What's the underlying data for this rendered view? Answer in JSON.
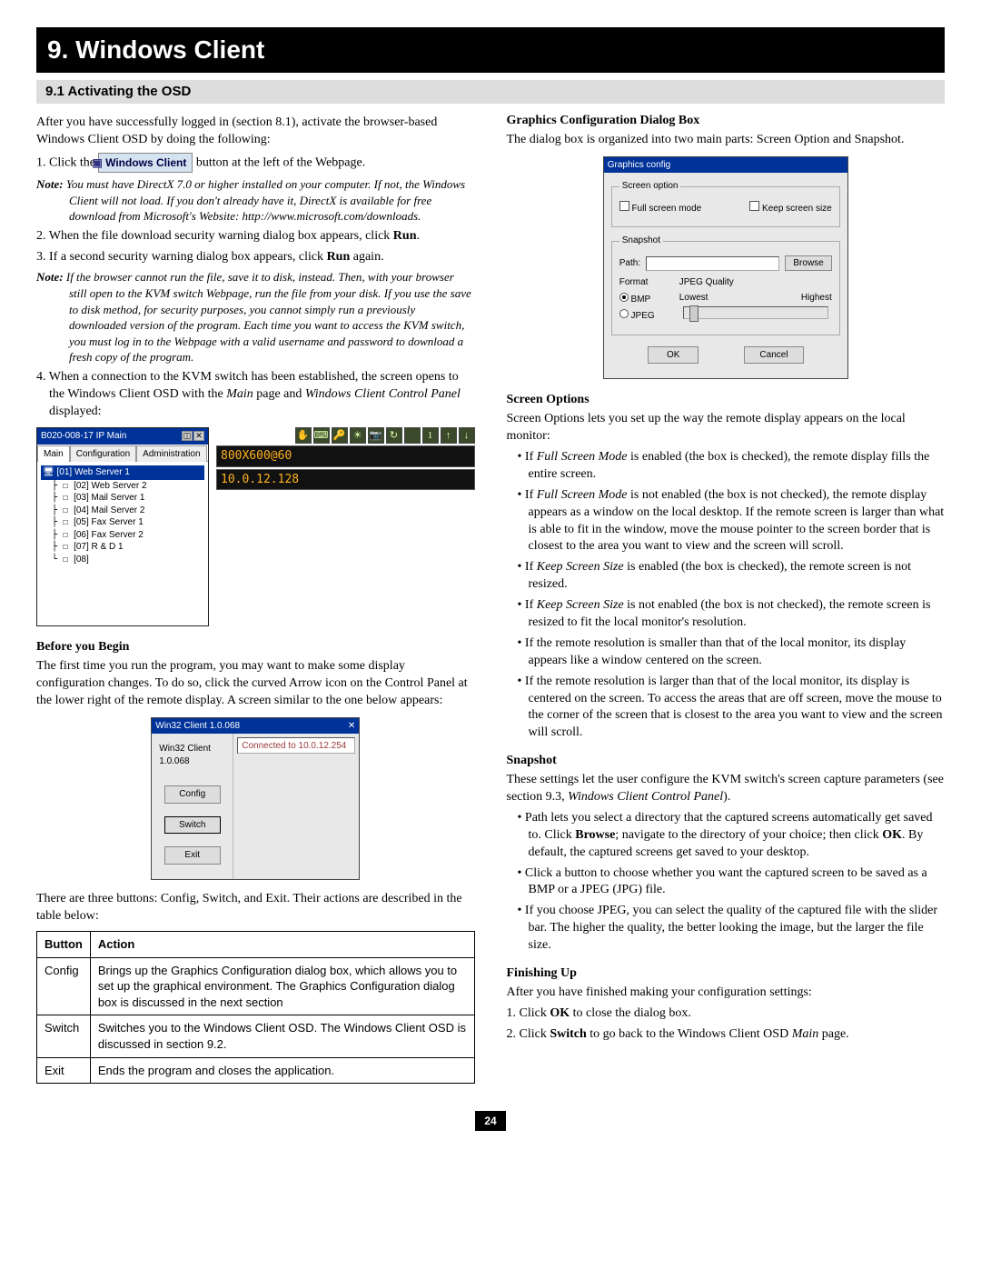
{
  "chapterTitle": "9. Windows Client",
  "sectionTitle": "9.1 Activating the OSD",
  "intro": "After you have successfully logged in (section 8.1), activate the browser-based Windows Client OSD by doing the following:",
  "step1_pre": "1. Click the",
  "winClientBtn": "Windows Client",
  "step1_post": "button at the left of the Webpage.",
  "note1_label": "Note:",
  "note1": "You must have DirectX 7.0 or higher installed on your computer. If not, the Windows Client will not load. If you don't already have it, DirectX is available for free download from Microsoft's Website: http://www.microsoft.com/downloads.",
  "step2_pre": "2. When the file download security warning dialog box appears, click",
  "runBold": "Run",
  "step3": "3. If a second security warning dialog box appears, click",
  "step3_post": "again.",
  "note2": "If the browser cannot run the file, save it to disk, instead. Then, with your browser still open to the KVM switch Webpage, run the file from your disk. If you use the save to disk method, for security purposes, you cannot simply run a previously downloaded version of the program. Each time you want to access the KVM switch, you must log in to the Webpage with a valid username and password to download a fresh copy of the program.",
  "step4": "4. When a connection to the KVM switch has been established, the screen opens to the Windows Client OSD with the",
  "mainItalic": "Main",
  "step4_b": "page and",
  "wccpItalic": "Windows Client Control Panel",
  "step4_c": "displayed:",
  "osd": {
    "title": "B020-008-17 IP Main",
    "tabs": [
      "Main",
      "Configuration",
      "Administration"
    ],
    "items": [
      "[01] Web Server 1",
      "[02] Web Server 2",
      "[03] Mail Server 1",
      "[04] Mail Server 2",
      "[05] Fax Server 1",
      "[06] Fax Server 2",
      "[07] R & D 1",
      "[08]"
    ],
    "lcd1": "800X600@60",
    "lcd2": "10.0.12.128"
  },
  "beforeHead": "Before you Begin",
  "beforePara": "The first time you run the program, you may want to make some display configuration changes. To do so, click the curved Arrow icon on the Control Panel at the lower right of the remote display. A screen similar to the one below appears:",
  "w32": {
    "title": "Win32 Client 1.0.068",
    "label": "Win32 Client 1.0.068",
    "btns": [
      "Config",
      "Switch",
      "Exit"
    ],
    "log": "Connected to 10.0.12.254"
  },
  "tableIntro": "There are three buttons: Config, Switch, and Exit. Their actions are described in the table below:",
  "table": {
    "head": [
      "Button",
      "Action"
    ],
    "rows": [
      [
        "Config",
        "Brings up the Graphics Configuration dialog box, which allows you to set up the graphical environment. The Graphics Configuration dialog box is discussed in the next section"
      ],
      [
        "Switch",
        "Switches you to the Windows Client OSD. The Windows Client OSD is discussed in section 9.2."
      ],
      [
        "Exit",
        "Ends the program and closes the application."
      ]
    ]
  },
  "gcHead": "Graphics Configuration Dialog Box",
  "gcPara": "The dialog box is organized into two main parts: Screen Option and Snapshot.",
  "gc": {
    "title": "Graphics config",
    "legend1": "Screen option",
    "full": "Full screen mode",
    "keep": "Keep screen size",
    "legend2": "Snapshot",
    "path": "Path:",
    "browse": "Browse",
    "format": "Format",
    "quality": "JPEG Quality",
    "bmp": "BMP",
    "jpeg": "JPEG",
    "lowest": "Lowest",
    "highest": "Highest",
    "ok": "OK",
    "cancel": "Cancel"
  },
  "soHead": "Screen Options",
  "soPara": "Screen Options lets you set up the way the remote display appears on the local monitor:",
  "soBullets": [
    {
      "pre": "If ",
      "i": "Full Screen Mode",
      "post": " is enabled (the box is checked), the remote display fills the entire screen."
    },
    {
      "pre": "If ",
      "i": "Full Screen Mode",
      "post": " is not enabled (the box is not checked), the remote display appears as a window on the local desktop. If the remote screen is larger than what is able to fit in the window, move the mouse pointer to the screen border that is closest to the area you want to view and the screen will scroll."
    },
    {
      "pre": "If ",
      "i": "Keep Screen Size",
      "post": " is enabled (the box is checked), the remote screen is not resized."
    },
    {
      "pre": "If ",
      "i": "Keep Screen Size",
      "post": " is not enabled (the box is not checked), the remote screen is resized to fit the local monitor's resolution."
    },
    {
      "plain": "If the remote resolution is smaller than that of the local monitor, its display appears like a window centered on the screen."
    },
    {
      "plain": "If the remote resolution is larger than that of the local monitor, its display is centered on the screen. To access the areas that are off screen, move the mouse to the corner of the screen that is closest to the area you want to view and the screen will scroll."
    }
  ],
  "snapHead": "Snapshot",
  "snapPara_a": "These settings let the user configure the KVM switch's screen capture parameters (see section 9.3,",
  "snapPara_i": "Windows Client Control Panel",
  "snapPara_b": ").",
  "snapBullets": [
    "Path lets you select a directory that the captured screens automatically get saved to. Click <b>Browse</b>; navigate to the directory of your choice; then click <b>OK</b>. By default, the captured screens get saved to your desktop.",
    "Click a button to choose whether you want the captured screen to be saved as a BMP or a JPEG (JPG) file.",
    "If you choose JPEG, you can select the quality of the captured file with the slider bar. The higher the quality, the better looking the image, but the larger the file size."
  ],
  "finHead": "Finishing Up",
  "finPara": "After you have finished making your configuration settings:",
  "fin1_a": "1. Click",
  "fin1_b": "OK",
  "fin1_c": "to close the dialog box.",
  "fin2_a": "2. Click",
  "fin2_b": "Switch",
  "fin2_c": "to go back to the Windows Client OSD",
  "fin2_i": "Main",
  "fin2_d": "page.",
  "pageNum": "24"
}
